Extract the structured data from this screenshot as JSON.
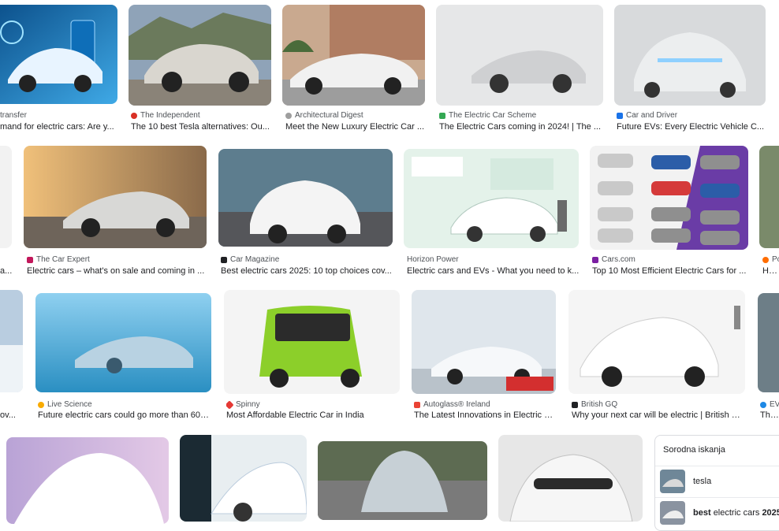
{
  "rows": [
    [
      {
        "source": "transfer",
        "title": "mand for electric cars: Are y...",
        "fav": "#6a6a6a"
      },
      {
        "source": "The Independent",
        "title": "The 10 best Tesla alternatives: Ou...",
        "fav": "#d93025"
      },
      {
        "source": "Architectural Digest",
        "title": "Meet the New Luxury Electric Car ...",
        "fav": "#9e9e9e"
      },
      {
        "source": "The Electric Car Scheme",
        "title": "The Electric Cars coming in 2024! | The ...",
        "fav": "#34a853"
      },
      {
        "source": "Car and Driver",
        "title": "Future EVs: Every Electric Vehicle C...",
        "fav": "#1a73e8"
      }
    ],
    [
      {
        "source": "",
        "title": "a...",
        "fav": ""
      },
      {
        "source": "The Car Expert",
        "title": "Electric cars – what's on sale and coming in ...",
        "fav": "#c2185b"
      },
      {
        "source": "Car Magazine",
        "title": "Best electric cars 2025: 10 top choices cov...",
        "fav": "#202124"
      },
      {
        "source": "Horizon Power",
        "title": "Electric cars and EVs - What you need to k...",
        "fav": ""
      },
      {
        "source": "Cars.com",
        "title": "Top 10 Most Efficient Electric Cars for ...",
        "fav": "#7b1fa2"
      },
      {
        "source": "Po",
        "title": "How",
        "fav": "#ff6d00"
      }
    ],
    [
      {
        "source": "",
        "title": "ov...",
        "fav": ""
      },
      {
        "source": "Live Science",
        "title": "Future electric cars could go more than 600...",
        "fav": "#f9ab00"
      },
      {
        "source": "Spinny",
        "title": "Most Affordable Electric Car in India",
        "fav": "#e53935"
      },
      {
        "source": "Autoglass® Ireland",
        "title": "The Latest Innovations in Electric C...",
        "fav": "#ea4335"
      },
      {
        "source": "British GQ",
        "title": "Why your next car will be electric | British G...",
        "fav": "#202124"
      },
      {
        "source": "EV",
        "title": "The F",
        "fav": "#1e88e5"
      }
    ]
  ],
  "related": {
    "heading": "Sorodna iskanja",
    "items": [
      {
        "label": "tesla",
        "label_bold": ""
      },
      {
        "label": "electric cars ",
        "label_bold": "best",
        "label_bold2": "2025"
      }
    ]
  }
}
